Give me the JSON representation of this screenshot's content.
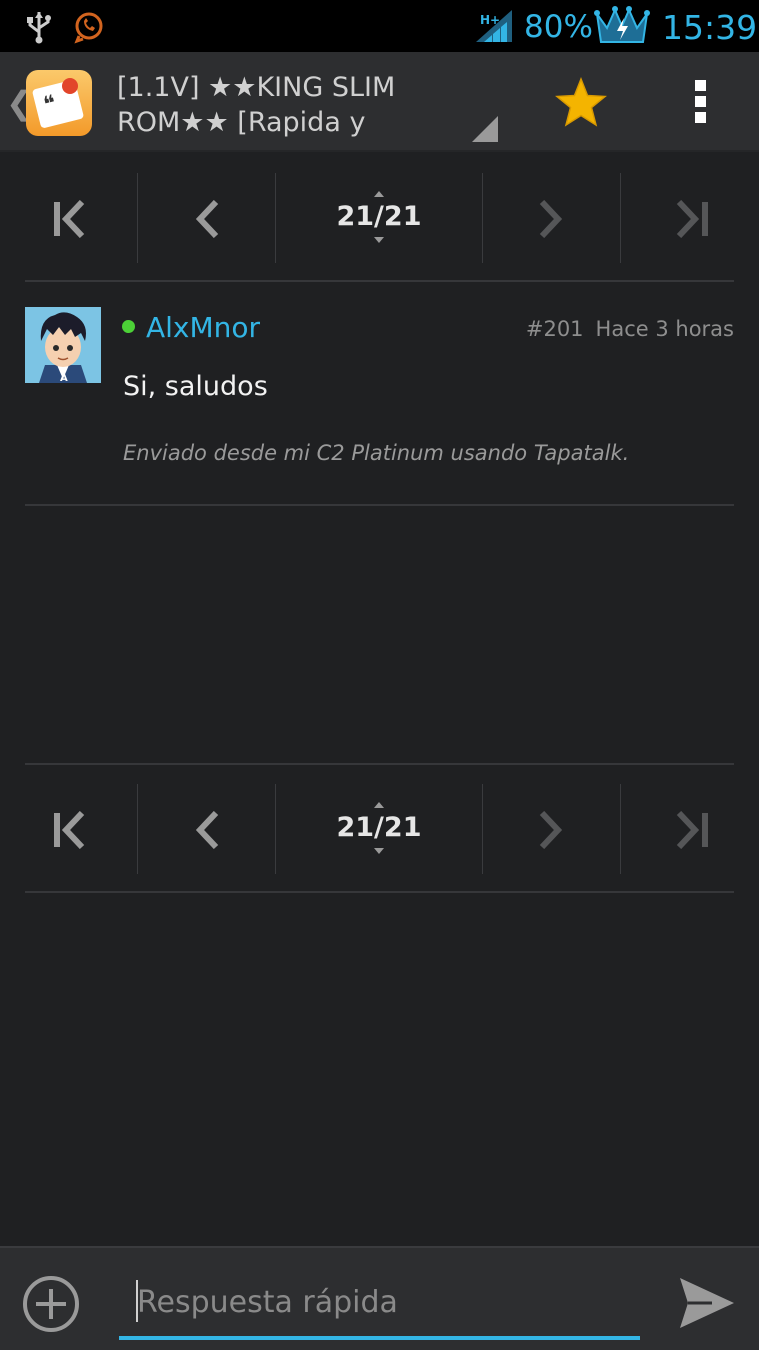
{
  "status_bar": {
    "battery_percent": "80%",
    "time": "15:39",
    "network_type": "H+",
    "accent_color": "#33b5e5",
    "icons": [
      "usb-icon",
      "whatsapp-icon",
      "signal-icon",
      "crown-battery-icon"
    ]
  },
  "action_bar": {
    "title": "[1.1V] ★★KING SLIM ROM★★ [Rapida y",
    "icons": [
      "back-caret-icon",
      "app-icon",
      "favorite-star-icon",
      "overflow-menu-icon"
    ],
    "star_color": "#f4b400"
  },
  "pagination": {
    "current": "21/21",
    "icons": [
      "first-page-icon",
      "prev-page-icon",
      "next-page-icon",
      "last-page-icon"
    ]
  },
  "post": {
    "username": "AlxMnor",
    "online": true,
    "post_number": "#201",
    "time_ago": "Hace 3 horas",
    "body": "Si, saludos",
    "signature": "Enviado desde mi C2 Platinum usando Tapatalk."
  },
  "reply_bar": {
    "placeholder": "Respuesta rápida",
    "icons": [
      "add-attachment-icon",
      "send-icon"
    ]
  }
}
